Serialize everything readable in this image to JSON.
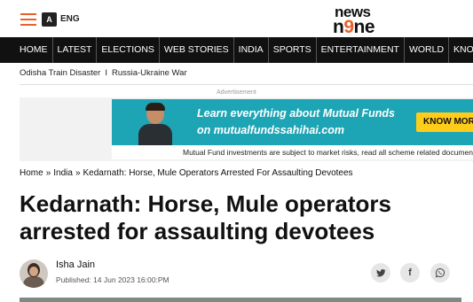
{
  "header": {
    "lang_icon_glyph": "A",
    "lang_label": "ENG",
    "logo_line1": "news",
    "logo_line2_a": "n",
    "logo_line2_b": "9",
    "logo_line2_c": "ne"
  },
  "nav": {
    "items": [
      "HOME",
      "LATEST",
      "ELECTIONS",
      "WEB STORIES",
      "INDIA",
      "SPORTS",
      "ENTERTAINMENT",
      "WORLD",
      "KNOWLEDGE"
    ]
  },
  "trending": {
    "items": [
      "Odisha Train Disaster",
      "Russia-Ukraine War"
    ],
    "separator": "I"
  },
  "ad": {
    "label": "Advertisement",
    "line1": "Learn everything about Mutual Funds",
    "line2": "on mutualfundssahihai.com",
    "cta": "KNOW MORE",
    "disclaimer": "Mutual Fund investments are subject to market risks, read all scheme related documents carefully.",
    "accent": "#1ea5b5",
    "cta_color": "#ffcc1a"
  },
  "breadcrumb": {
    "items": [
      "Home",
      "India",
      "Kedarnath: Horse, Mule Operators Arrested For Assaulting Devotees"
    ],
    "separator": "»"
  },
  "article": {
    "headline": "Kedarnath: Horse, Mule operators arrested for assaulting devotees",
    "author": "Isha Jain",
    "published": "Published: 14 Jun 2023 16:00:PM"
  },
  "share": {
    "icons": [
      "twitter-icon",
      "facebook-icon",
      "whatsapp-icon"
    ],
    "facebook_glyph": "f"
  },
  "colors": {
    "brand_orange": "#e8612c",
    "nav_bg": "#111111"
  }
}
